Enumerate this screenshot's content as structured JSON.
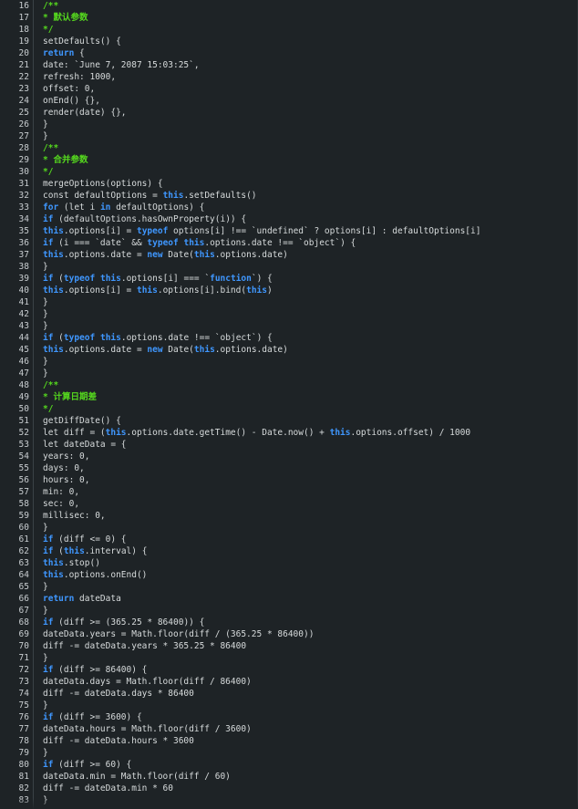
{
  "editor": {
    "colors": {
      "background": "#1e2326",
      "keyword": "#3f97ff",
      "comment": "#55d81e",
      "text": "#d7dbdc",
      "line_number": "#c8cdd0"
    },
    "lines": [
      {
        "n": "16",
        "tokens": [
          [
            "cm",
            "/**"
          ]
        ]
      },
      {
        "n": "17",
        "tokens": [
          [
            "cm",
            "* 默认参数"
          ]
        ]
      },
      {
        "n": "18",
        "tokens": [
          [
            "cm",
            "*/"
          ]
        ]
      },
      {
        "n": "19",
        "tokens": [
          [
            "t",
            "setDefaults() {"
          ]
        ]
      },
      {
        "n": "20",
        "tokens": [
          [
            "kw",
            "return"
          ],
          [
            "t",
            " {"
          ]
        ]
      },
      {
        "n": "21",
        "tokens": [
          [
            "t",
            "date: `June 7, 2087 15:03:25`,"
          ]
        ]
      },
      {
        "n": "22",
        "tokens": [
          [
            "t",
            "refresh: 1000,"
          ]
        ]
      },
      {
        "n": "23",
        "tokens": [
          [
            "t",
            "offset: 0,"
          ]
        ]
      },
      {
        "n": "24",
        "tokens": [
          [
            "t",
            "onEnd() {},"
          ]
        ]
      },
      {
        "n": "25",
        "tokens": [
          [
            "t",
            "render(date) {},"
          ]
        ]
      },
      {
        "n": "26",
        "tokens": [
          [
            "t",
            "}"
          ]
        ]
      },
      {
        "n": "27",
        "tokens": [
          [
            "t",
            "}"
          ]
        ]
      },
      {
        "n": "28",
        "tokens": [
          [
            "cm",
            "/**"
          ]
        ]
      },
      {
        "n": "29",
        "tokens": [
          [
            "cm",
            "* 合并参数"
          ]
        ]
      },
      {
        "n": "30",
        "tokens": [
          [
            "cm",
            "*/"
          ]
        ]
      },
      {
        "n": "31",
        "tokens": [
          [
            "t",
            "mergeOptions(options) {"
          ]
        ]
      },
      {
        "n": "32",
        "tokens": [
          [
            "t",
            "const defaultOptions = "
          ],
          [
            "kw",
            "this"
          ],
          [
            "t",
            ".setDefaults()"
          ]
        ]
      },
      {
        "n": "33",
        "tokens": [
          [
            "kw",
            "for"
          ],
          [
            "t",
            " (let i "
          ],
          [
            "kw",
            "in"
          ],
          [
            "t",
            " defaultOptions) {"
          ]
        ]
      },
      {
        "n": "34",
        "tokens": [
          [
            "kw",
            "if"
          ],
          [
            "t",
            " (defaultOptions.hasOwnProperty(i)) {"
          ]
        ]
      },
      {
        "n": "35",
        "tokens": [
          [
            "kw",
            "this"
          ],
          [
            "t",
            ".options[i] = "
          ],
          [
            "kw",
            "typeof"
          ],
          [
            "t",
            " options[i] !== `undefined` ? options[i] : defaultOptions[i]"
          ]
        ]
      },
      {
        "n": "36",
        "tokens": [
          [
            "kw",
            "if"
          ],
          [
            "t",
            " (i === `date` && "
          ],
          [
            "kw",
            "typeof"
          ],
          [
            "t",
            " "
          ],
          [
            "kw",
            "this"
          ],
          [
            "t",
            ".options.date !== `object`) {"
          ]
        ]
      },
      {
        "n": "37",
        "tokens": [
          [
            "kw",
            "this"
          ],
          [
            "t",
            ".options.date = "
          ],
          [
            "kw",
            "new"
          ],
          [
            "t",
            " Date("
          ],
          [
            "kw",
            "this"
          ],
          [
            "t",
            ".options.date)"
          ]
        ]
      },
      {
        "n": "38",
        "tokens": [
          [
            "t",
            "}"
          ]
        ]
      },
      {
        "n": "39",
        "tokens": [
          [
            "kw",
            "if"
          ],
          [
            "t",
            " ("
          ],
          [
            "kw",
            "typeof"
          ],
          [
            "t",
            " "
          ],
          [
            "kw",
            "this"
          ],
          [
            "t",
            ".options[i] === `"
          ],
          [
            "kw",
            "function"
          ],
          [
            "t",
            "`) {"
          ]
        ]
      },
      {
        "n": "40",
        "tokens": [
          [
            "kw",
            "this"
          ],
          [
            "t",
            ".options[i] = "
          ],
          [
            "kw",
            "this"
          ],
          [
            "t",
            ".options[i].bind("
          ],
          [
            "kw",
            "this"
          ],
          [
            "t",
            ")"
          ]
        ]
      },
      {
        "n": "41",
        "tokens": [
          [
            "t",
            "}"
          ]
        ]
      },
      {
        "n": "42",
        "tokens": [
          [
            "t",
            "}"
          ]
        ]
      },
      {
        "n": "43",
        "tokens": [
          [
            "t",
            "}"
          ]
        ]
      },
      {
        "n": "44",
        "tokens": [
          [
            "kw",
            "if"
          ],
          [
            "t",
            " ("
          ],
          [
            "kw",
            "typeof"
          ],
          [
            "t",
            " "
          ],
          [
            "kw",
            "this"
          ],
          [
            "t",
            ".options.date !== `object`) {"
          ]
        ]
      },
      {
        "n": "45",
        "tokens": [
          [
            "kw",
            "this"
          ],
          [
            "t",
            ".options.date = "
          ],
          [
            "kw",
            "new"
          ],
          [
            "t",
            " Date("
          ],
          [
            "kw",
            "this"
          ],
          [
            "t",
            ".options.date)"
          ]
        ]
      },
      {
        "n": "46",
        "tokens": [
          [
            "t",
            "}"
          ]
        ]
      },
      {
        "n": "47",
        "tokens": [
          [
            "t",
            "}"
          ]
        ]
      },
      {
        "n": "48",
        "tokens": [
          [
            "cm",
            "/**"
          ]
        ]
      },
      {
        "n": "49",
        "tokens": [
          [
            "cm",
            "* 计算日期差"
          ]
        ]
      },
      {
        "n": "50",
        "tokens": [
          [
            "cm",
            "*/"
          ]
        ]
      },
      {
        "n": "51",
        "tokens": [
          [
            "t",
            "getDiffDate() {"
          ]
        ]
      },
      {
        "n": "52",
        "tokens": [
          [
            "t",
            "let diff = ("
          ],
          [
            "kw",
            "this"
          ],
          [
            "t",
            ".options.date.getTime() - Date.now() + "
          ],
          [
            "kw",
            "this"
          ],
          [
            "t",
            ".options.offset) / 1000"
          ]
        ]
      },
      {
        "n": "53",
        "tokens": [
          [
            "t",
            "let dateData = {"
          ]
        ]
      },
      {
        "n": "54",
        "tokens": [
          [
            "t",
            "years: 0,"
          ]
        ]
      },
      {
        "n": "55",
        "tokens": [
          [
            "t",
            "days: 0,"
          ]
        ]
      },
      {
        "n": "56",
        "tokens": [
          [
            "t",
            "hours: 0,"
          ]
        ]
      },
      {
        "n": "57",
        "tokens": [
          [
            "t",
            "min: 0,"
          ]
        ]
      },
      {
        "n": "58",
        "tokens": [
          [
            "t",
            "sec: 0,"
          ]
        ]
      },
      {
        "n": "59",
        "tokens": [
          [
            "t",
            "millisec: 0,"
          ]
        ]
      },
      {
        "n": "60",
        "tokens": [
          [
            "t",
            "}"
          ]
        ]
      },
      {
        "n": "61",
        "tokens": [
          [
            "kw",
            "if"
          ],
          [
            "t",
            " (diff <= 0) {"
          ]
        ]
      },
      {
        "n": "62",
        "tokens": [
          [
            "kw",
            "if"
          ],
          [
            "t",
            " ("
          ],
          [
            "kw",
            "this"
          ],
          [
            "t",
            ".interval) {"
          ]
        ]
      },
      {
        "n": "63",
        "tokens": [
          [
            "kw",
            "this"
          ],
          [
            "t",
            ".stop()"
          ]
        ]
      },
      {
        "n": "64",
        "tokens": [
          [
            "kw",
            "this"
          ],
          [
            "t",
            ".options.onEnd()"
          ]
        ]
      },
      {
        "n": "65",
        "tokens": [
          [
            "t",
            "}"
          ]
        ]
      },
      {
        "n": "66",
        "tokens": [
          [
            "kw",
            "return"
          ],
          [
            "t",
            " dateData"
          ]
        ]
      },
      {
        "n": "67",
        "tokens": [
          [
            "t",
            "}"
          ]
        ]
      },
      {
        "n": "68",
        "tokens": [
          [
            "kw",
            "if"
          ],
          [
            "t",
            " (diff >= (365.25 * 86400)) {"
          ]
        ]
      },
      {
        "n": "69",
        "tokens": [
          [
            "t",
            "dateData.years = Math.floor(diff / (365.25 * 86400))"
          ]
        ]
      },
      {
        "n": "70",
        "tokens": [
          [
            "t",
            "diff -= dateData.years * 365.25 * 86400"
          ]
        ]
      },
      {
        "n": "71",
        "tokens": [
          [
            "t",
            "}"
          ]
        ]
      },
      {
        "n": "72",
        "tokens": [
          [
            "kw",
            "if"
          ],
          [
            "t",
            " (diff >= 86400) {"
          ]
        ]
      },
      {
        "n": "73",
        "tokens": [
          [
            "t",
            "dateData.days = Math.floor(diff / 86400)"
          ]
        ]
      },
      {
        "n": "74",
        "tokens": [
          [
            "t",
            "diff -= dateData.days * 86400"
          ]
        ]
      },
      {
        "n": "75",
        "tokens": [
          [
            "t",
            "}"
          ]
        ]
      },
      {
        "n": "76",
        "tokens": [
          [
            "kw",
            "if"
          ],
          [
            "t",
            " (diff >= 3600) {"
          ]
        ]
      },
      {
        "n": "77",
        "tokens": [
          [
            "t",
            "dateData.hours = Math.floor(diff / 3600)"
          ]
        ]
      },
      {
        "n": "78",
        "tokens": [
          [
            "t",
            "diff -= dateData.hours * 3600"
          ]
        ]
      },
      {
        "n": "79",
        "tokens": [
          [
            "t",
            "}"
          ]
        ]
      },
      {
        "n": "80",
        "tokens": [
          [
            "kw",
            "if"
          ],
          [
            "t",
            " (diff >= 60) {"
          ]
        ]
      },
      {
        "n": "81",
        "tokens": [
          [
            "t",
            "dateData.min = Math.floor(diff / 60)"
          ]
        ]
      },
      {
        "n": "82",
        "tokens": [
          [
            "t",
            "diff -= dateData.min * 60"
          ]
        ]
      },
      {
        "n": "83",
        "tokens": [
          [
            "t",
            "}"
          ]
        ]
      }
    ]
  }
}
